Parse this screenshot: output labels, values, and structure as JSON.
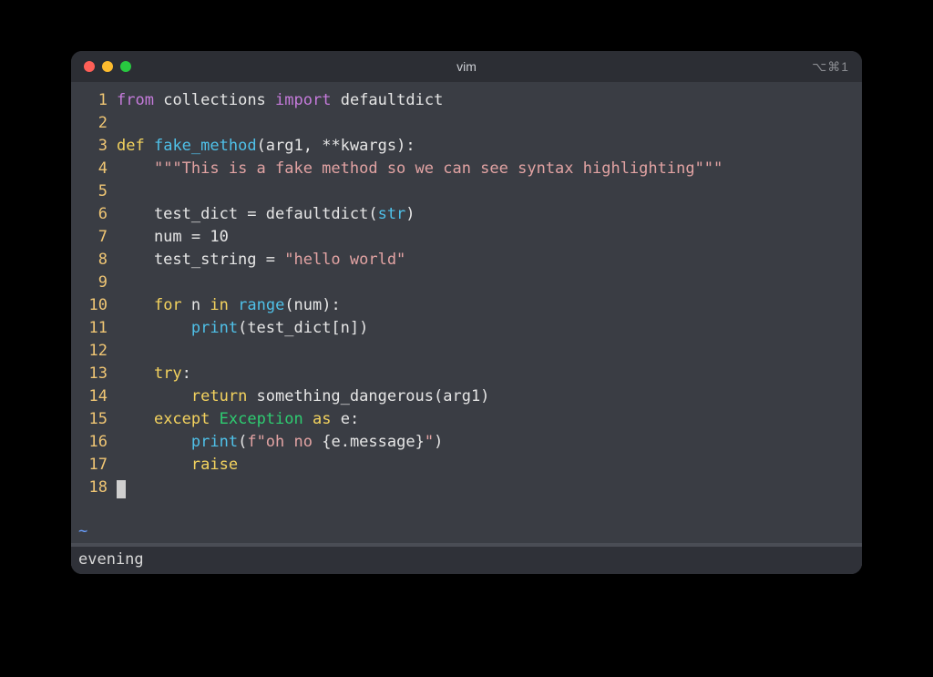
{
  "window": {
    "title": "vim",
    "right_indicator": "⌥⌘1"
  },
  "lines": [
    {
      "num": 1,
      "tokens": [
        {
          "t": "from",
          "c": "kw-import"
        },
        {
          "t": " ",
          "c": "plain"
        },
        {
          "t": "collections",
          "c": "plain"
        },
        {
          "t": " ",
          "c": "plain"
        },
        {
          "t": "import",
          "c": "kw-import"
        },
        {
          "t": " ",
          "c": "plain"
        },
        {
          "t": "defaultdict",
          "c": "plain"
        }
      ]
    },
    {
      "num": 2,
      "tokens": []
    },
    {
      "num": 3,
      "tokens": [
        {
          "t": "def",
          "c": "kw"
        },
        {
          "t": " ",
          "c": "plain"
        },
        {
          "t": "fake_method",
          "c": "fn"
        },
        {
          "t": "(arg1, **kwargs):",
          "c": "plain"
        }
      ]
    },
    {
      "num": 4,
      "tokens": [
        {
          "t": "    ",
          "c": "plain"
        },
        {
          "t": "\"\"\"This is a fake method so we can see syntax highlighting\"\"\"",
          "c": "str"
        }
      ]
    },
    {
      "num": 5,
      "tokens": []
    },
    {
      "num": 6,
      "tokens": [
        {
          "t": "    test_dict = defaultdict(",
          "c": "plain"
        },
        {
          "t": "str",
          "c": "builtin"
        },
        {
          "t": ")",
          "c": "plain"
        }
      ]
    },
    {
      "num": 7,
      "tokens": [
        {
          "t": "    num = 10",
          "c": "plain"
        }
      ]
    },
    {
      "num": 8,
      "tokens": [
        {
          "t": "    test_string = ",
          "c": "plain"
        },
        {
          "t": "\"hello world\"",
          "c": "str"
        }
      ]
    },
    {
      "num": 9,
      "tokens": []
    },
    {
      "num": 10,
      "tokens": [
        {
          "t": "    ",
          "c": "plain"
        },
        {
          "t": "for",
          "c": "kw"
        },
        {
          "t": " n ",
          "c": "plain"
        },
        {
          "t": "in",
          "c": "kw"
        },
        {
          "t": " ",
          "c": "plain"
        },
        {
          "t": "range",
          "c": "builtin"
        },
        {
          "t": "(num):",
          "c": "plain"
        }
      ]
    },
    {
      "num": 11,
      "tokens": [
        {
          "t": "        ",
          "c": "plain"
        },
        {
          "t": "print",
          "c": "builtin"
        },
        {
          "t": "(test_dict[n])",
          "c": "plain"
        }
      ]
    },
    {
      "num": 12,
      "tokens": []
    },
    {
      "num": 13,
      "tokens": [
        {
          "t": "    ",
          "c": "plain"
        },
        {
          "t": "try",
          "c": "kw"
        },
        {
          "t": ":",
          "c": "plain"
        }
      ]
    },
    {
      "num": 14,
      "tokens": [
        {
          "t": "        ",
          "c": "plain"
        },
        {
          "t": "return",
          "c": "kw"
        },
        {
          "t": " something_dangerous(arg1)",
          "c": "plain"
        }
      ]
    },
    {
      "num": 15,
      "tokens": [
        {
          "t": "    ",
          "c": "plain"
        },
        {
          "t": "except",
          "c": "kw"
        },
        {
          "t": " ",
          "c": "plain"
        },
        {
          "t": "Exception",
          "c": "type"
        },
        {
          "t": " ",
          "c": "plain"
        },
        {
          "t": "as",
          "c": "kw"
        },
        {
          "t": " e:",
          "c": "plain"
        }
      ]
    },
    {
      "num": 16,
      "tokens": [
        {
          "t": "        ",
          "c": "plain"
        },
        {
          "t": "print",
          "c": "builtin"
        },
        {
          "t": "(",
          "c": "plain"
        },
        {
          "t": "f\"oh no ",
          "c": "str"
        },
        {
          "t": "{",
          "c": "plain"
        },
        {
          "t": "e.message",
          "c": "plain"
        },
        {
          "t": "}",
          "c": "plain"
        },
        {
          "t": "\"",
          "c": "str"
        },
        {
          "t": ")",
          "c": "plain"
        }
      ]
    },
    {
      "num": 17,
      "tokens": [
        {
          "t": "        ",
          "c": "plain"
        },
        {
          "t": "raise",
          "c": "kw"
        }
      ]
    },
    {
      "num": 18,
      "tokens": [],
      "cursor": true
    }
  ],
  "tilde": "~",
  "status": "evening"
}
